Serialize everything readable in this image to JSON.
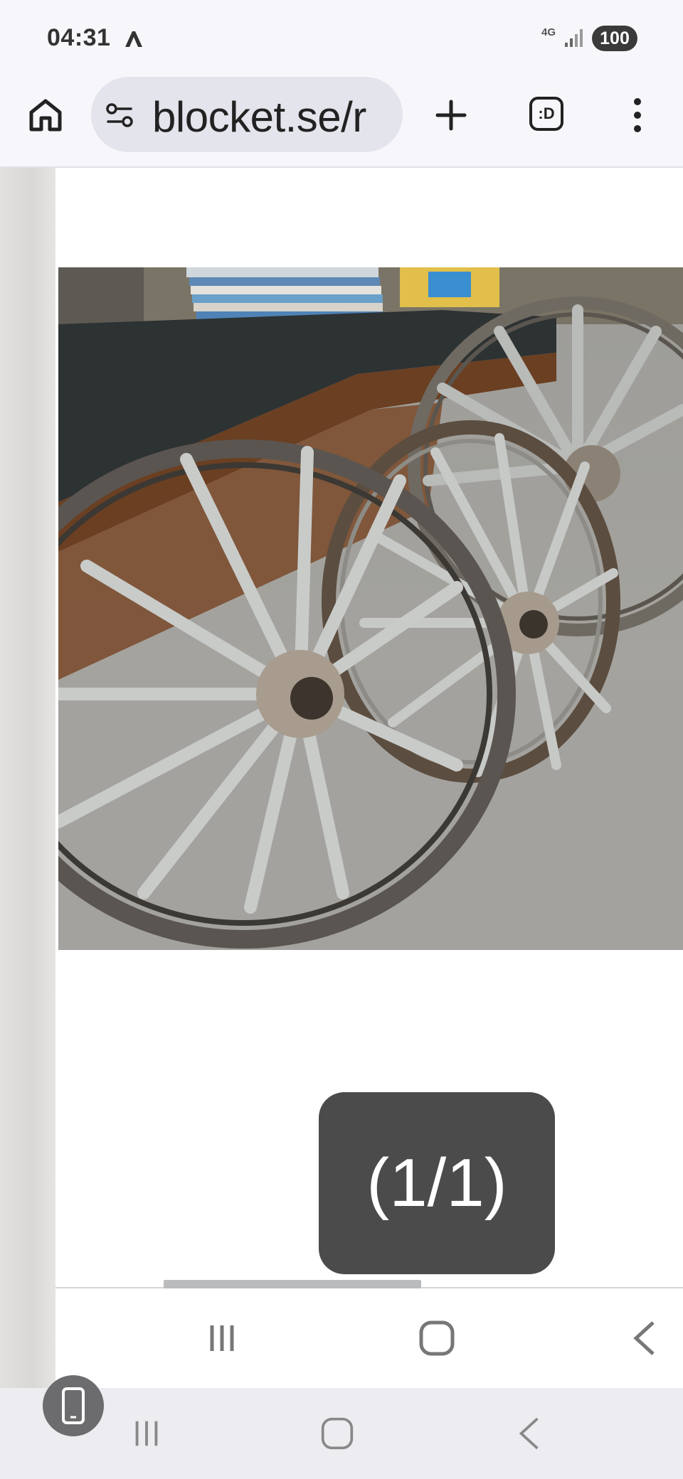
{
  "status_bar": {
    "time": "04:31",
    "network": "4G",
    "battery": "100"
  },
  "browser": {
    "url": "blocket.se/r",
    "tabs_label": ":D"
  },
  "gallery": {
    "counter": "(1/1)",
    "image_alt": "Three old wooden wagon wheels with iron rims leaning against a bench"
  },
  "icons": {
    "home": "home-icon",
    "site_info": "site-info-icon",
    "new_tab": "plus-icon",
    "menu": "more-vert-icon",
    "recents": "recents-icon",
    "home_nav": "home-nav-icon",
    "back": "back-icon"
  },
  "colors": {
    "toolbar_bg": "#f7f7fb",
    "url_pill_bg": "#e4e4ec",
    "counter_bg": "#4b4b4b",
    "nav_bg": "#ececf1"
  }
}
